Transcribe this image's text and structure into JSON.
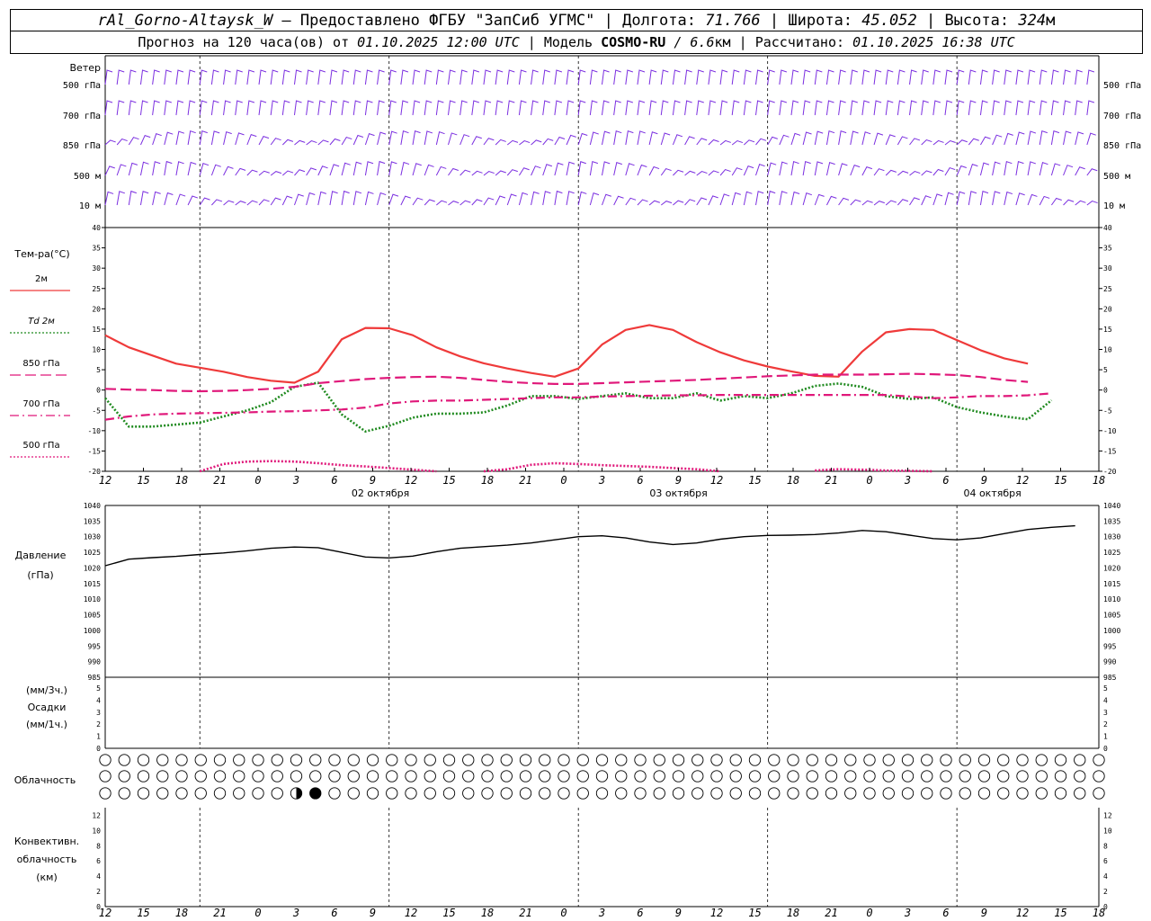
{
  "header": {
    "station": "rAl_Gorno-Altaysk_W",
    "provider": "— Предоставлено ФГБУ \"ЗапСиб УГМС\"",
    "lon_label": "Долгота:",
    "lon": "71.766",
    "lat_label": "Широта:",
    "lat": "45.052",
    "alt_label": "Высота:",
    "alt": "324",
    "alt_unit": "м",
    "forecast_label": "Прогноз на 120 часа(ов) от",
    "forecast_from": "01.10.2025 12:00 UTC",
    "model_label": "Модель",
    "model": "COSMO-RU",
    "model_res": "/ 6.6",
    "model_res_unit": "км",
    "computed_label": "Рассчитано:",
    "computed": "01.10.2025 16:38 UTC"
  },
  "colors": {
    "wind": "#7b2fe0",
    "t2m": "#ef3a3a",
    "td2m": "#1f8a1f",
    "t850": "#e0187a",
    "t700": "#e0187a",
    "t500": "#e0187a",
    "pressure": "#000000",
    "grid": "#000000"
  },
  "chart_data": [
    {
      "type": "wind_barbs",
      "panel_label": "Ветер",
      "levels": [
        "500 гПа",
        "700 гПа",
        "850 гПа",
        "500 м",
        "10 м"
      ]
    },
    {
      "type": "line",
      "ylabel": "Тем-ра(°C)",
      "ylim": [
        -20,
        40
      ],
      "yticks": [
        -20,
        -15,
        -10,
        -5,
        0,
        5,
        10,
        15,
        20,
        25,
        30,
        35,
        40
      ],
      "x_hours": [
        0,
        3,
        6,
        9,
        12,
        15,
        18,
        21,
        24,
        27,
        30,
        33,
        36,
        39,
        42,
        45,
        48,
        51,
        54,
        57,
        60,
        63,
        66,
        69,
        72,
        75,
        78,
        81,
        84,
        87,
        90,
        93,
        96,
        99,
        102,
        105,
        108,
        111,
        114,
        117,
        120,
        123,
        126
      ],
      "x_tick_labels": [
        "12",
        "15",
        "18",
        "21",
        "0",
        "3",
        "6",
        "9",
        "12",
        "15",
        "18",
        "21",
        "0",
        "3",
        "6",
        "9",
        "12",
        "15",
        "18",
        "21",
        "0",
        "3",
        "6",
        "9",
        "12",
        "15",
        "18"
      ],
      "date_labels": [
        {
          "hour": 24,
          "text": "02 октября"
        },
        {
          "hour": 48,
          "text": "03 октября"
        },
        {
          "hour": 72,
          "text": "04 октября"
        }
      ],
      "series": [
        {
          "name": "2м",
          "style": "solid",
          "values": [
            13.5,
            10.5,
            8.5,
            6.5,
            5.5,
            4.5,
            3.2,
            2.3,
            1.8,
            4.5,
            12.5,
            15.3,
            15.2,
            13.5,
            10.5,
            8.3,
            6.6,
            5.3,
            4.2,
            3.3,
            5.3,
            11.2,
            14.8,
            16.0,
            14.8,
            11.8,
            9.3,
            7.3,
            5.8,
            4.6,
            3.5,
            3.3,
            9.5,
            14.2,
            15.0,
            14.8,
            12.3,
            9.8,
            7.8,
            6.5
          ]
        },
        {
          "name": "Td 2м",
          "style": "dotted",
          "values": [
            -2,
            -9,
            -9,
            -8.5,
            -8,
            -6.5,
            -5,
            -3,
            0.8,
            1.8,
            -6,
            -10.2,
            -8.8,
            -6.8,
            -5.8,
            -5.8,
            -5.5,
            -3.8,
            -1.5,
            -1.5,
            -2.2,
            -1.5,
            -0.8,
            -2.0,
            -2.0,
            -0.8,
            -2.6,
            -1.5,
            -2.0,
            -0.8,
            1.0,
            1.6,
            0.8,
            -1.5,
            -2.2,
            -1.8,
            -4.2,
            -5.5,
            -6.5,
            -7.2,
            -2.5
          ]
        },
        {
          "name": "850 гПа",
          "style": "dashed",
          "values": [
            0.3,
            0.1,
            0,
            -0.2,
            -0.3,
            -0.2,
            0,
            0.3,
            0.8,
            1.7,
            2.2,
            2.7,
            3.0,
            3.2,
            3.3,
            3.0,
            2.5,
            2.0,
            1.7,
            1.5,
            1.5,
            1.7,
            1.9,
            2.1,
            2.3,
            2.5,
            2.8,
            3.1,
            3.4,
            3.6,
            3.8,
            3.8,
            3.8,
            3.9,
            4.0,
            3.9,
            3.7,
            3.2,
            2.5,
            2.0
          ]
        },
        {
          "name": "700 гПа",
          "style": "dashdot",
          "values": [
            -7.3,
            -6.5,
            -6,
            -5.8,
            -5.7,
            -5.6,
            -5.5,
            -5.3,
            -5.2,
            -5,
            -4.8,
            -4.3,
            -3.3,
            -2.8,
            -2.6,
            -2.6,
            -2.4,
            -2.2,
            -2.0,
            -1.8,
            -1.8,
            -1.6,
            -1.5,
            -1.4,
            -1.3,
            -1.3,
            -1.2,
            -1.2,
            -1.2,
            -1.2,
            -1.2,
            -1.2,
            -1.2,
            -1.2,
            -1.6,
            -2.0,
            -1.8,
            -1.5,
            -1.5,
            -1.3,
            -0.8
          ]
        },
        {
          "name": "500 гПа",
          "style": "dotted",
          "values": [
            null,
            null,
            null,
            null,
            -20,
            -18.2,
            -17.6,
            -17.5,
            -17.6,
            -18,
            -18.5,
            -18.8,
            -19.2,
            -19.6,
            -20,
            null,
            -20,
            -19.5,
            -18.4,
            -18,
            -18.2,
            -18.5,
            -18.7,
            -18.9,
            -19.2,
            -19.5,
            -20,
            null,
            null,
            null,
            -19.8,
            -19.5,
            -19.6,
            -19.8,
            -19.9,
            -20
          ]
        }
      ]
    },
    {
      "type": "line",
      "ylabel": "Давление",
      "unit": "(гПа)",
      "ylim": [
        985,
        1040
      ],
      "yticks": [
        985,
        990,
        995,
        1000,
        1005,
        1010,
        1015,
        1020,
        1025,
        1030,
        1035,
        1040
      ],
      "series": [
        {
          "name": "pressure",
          "values": [
            1020.7,
            1022.8,
            1023.3,
            1023.7,
            1024.3,
            1024.8,
            1025.5,
            1026.3,
            1026.7,
            1026.5,
            1025.0,
            1023.5,
            1023.2,
            1023.8,
            1025.2,
            1026.3,
            1026.8,
            1027.3,
            1028.0,
            1029.0,
            1030.0,
            1030.3,
            1029.6,
            1028.3,
            1027.5,
            1028.0,
            1029.2,
            1030.0,
            1030.4,
            1030.5,
            1030.7,
            1031.2,
            1032.0,
            1031.6,
            1030.5,
            1029.4,
            1029.0,
            1029.6,
            1031.0,
            1032.3,
            1033.0,
            1033.5
          ]
        }
      ]
    },
    {
      "type": "bar",
      "ylabel_top": "(мм/3ч.)",
      "ylabel": "Осадки",
      "ylabel_bottom": "(мм/1ч.)",
      "ylim": [
        0,
        5
      ],
      "yticks": [
        0,
        1,
        2,
        3,
        4,
        5
      ],
      "values": []
    },
    {
      "type": "cloud_cover",
      "label": "Облачность",
      "count_per_row": 53,
      "rows": [
        "upper",
        "middle",
        "lower"
      ],
      "nonzero": [
        {
          "row": 2,
          "index": 10,
          "fraction": 0.5
        },
        {
          "row": 2,
          "index": 11,
          "fraction": 1.0
        }
      ]
    },
    {
      "type": "bar",
      "ylabel": "Конвективн.",
      "ylabel2": "облачность",
      "unit": "(км)",
      "ylim": [
        0,
        13
      ],
      "yticks": [
        0,
        2,
        4,
        6,
        8,
        10,
        12
      ],
      "values": []
    }
  ]
}
